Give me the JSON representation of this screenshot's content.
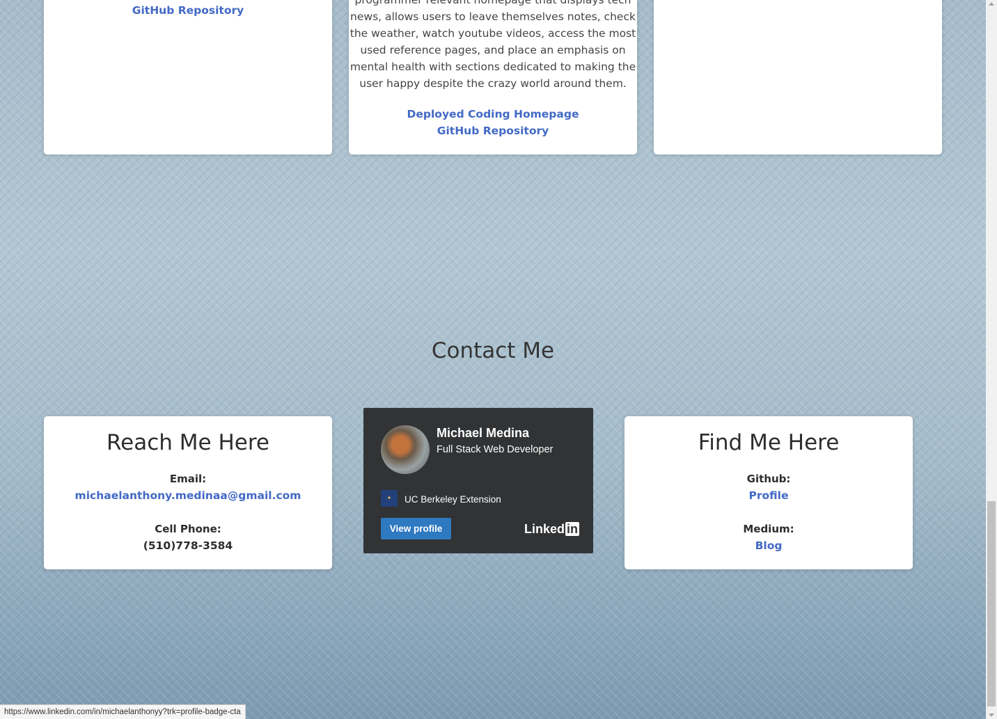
{
  "projects": {
    "left": {
      "github_link": "GitHub Repository"
    },
    "center": {
      "description_lines": [
        "programmer relevant homepage that displays tech",
        "news, allows users to leave themselves notes, check",
        "the weather, watch youtube videos, access the most",
        "used reference pages, and place an emphasis on",
        "mental health with sections dedicated to making the",
        "user happy despite the crazy world around them."
      ],
      "deployed_link": "Deployed Coding Homepage",
      "github_link": "GitHub Repository"
    }
  },
  "contact": {
    "title": "Contact Me",
    "reach": {
      "heading": "Reach Me Here",
      "email_label": "Email:",
      "email": "michaelanthony.medinaa@gmail.com",
      "phone_label": "Cell Phone:",
      "phone": "(510)778-3584"
    },
    "linkedin": {
      "name": "Michael Medina",
      "title": "Full Stack Web Developer",
      "school": "UC Berkeley Extension",
      "button": "View profile",
      "logo_text": "Linked",
      "logo_in": "in"
    },
    "find": {
      "heading": "Find Me Here",
      "github_label": "Github:",
      "github_link": "Profile",
      "medium_label": "Medium:",
      "medium_link": "Blog"
    }
  },
  "status_bar": {
    "url": "https://www.linkedin.com/in/michaelanthonyy?trk=profile-badge-cta"
  }
}
